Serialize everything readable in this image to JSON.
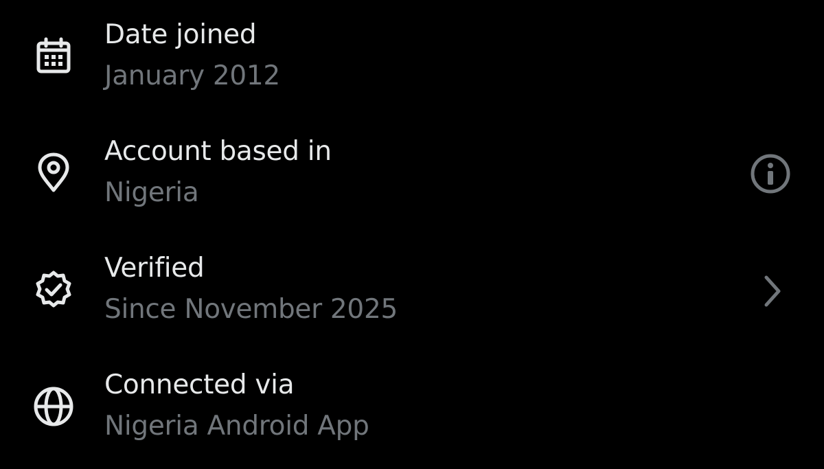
{
  "theme": {
    "background": "#000000",
    "title_color": "#e7e9ea",
    "value_color": "#71767b"
  },
  "about": {
    "rows": [
      {
        "title": "Date joined",
        "value": "January 2012",
        "icon": "calendar-icon"
      },
      {
        "title": "Account based in",
        "value": "Nigeria",
        "icon": "location-pin-icon",
        "trailing_icon": "info-icon"
      },
      {
        "title": "Verified",
        "value": "Since November 2025",
        "icon": "verified-badge-icon",
        "trailing_icon": "chevron-right-icon"
      },
      {
        "title": "Connected via",
        "value": "Nigeria Android App",
        "icon": "globe-icon"
      }
    ]
  }
}
